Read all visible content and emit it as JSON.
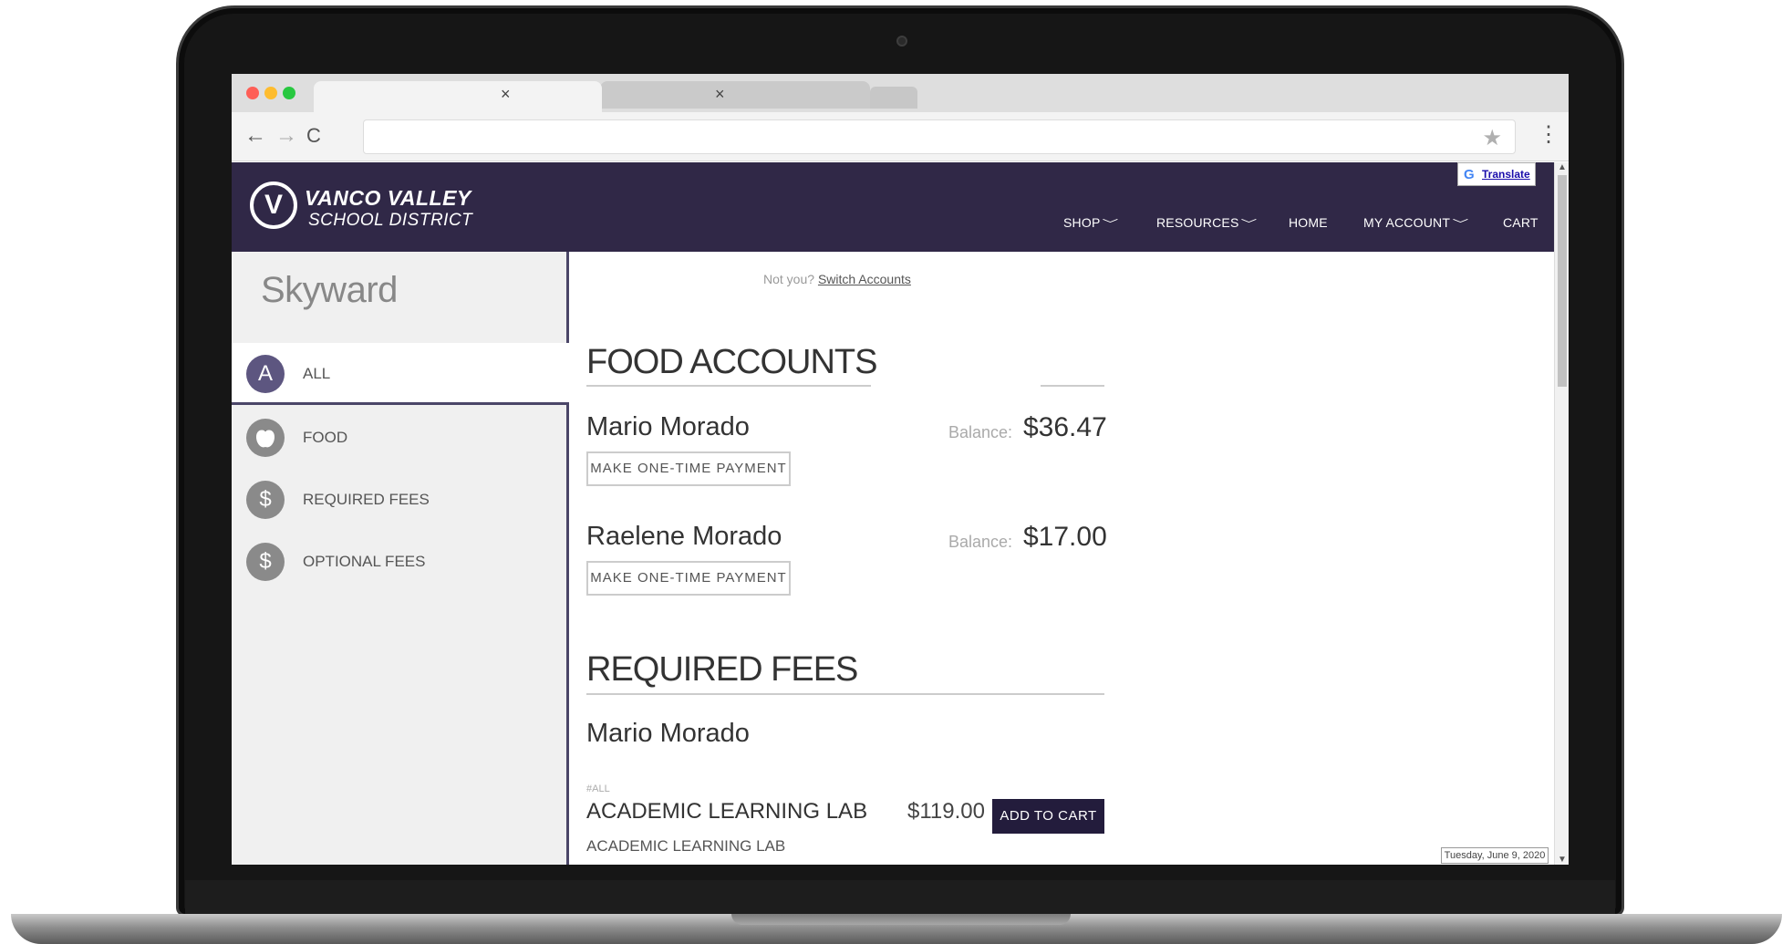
{
  "browser": {
    "traffic_light_colors": [
      "#fe5f57",
      "#febc2e",
      "#28c840"
    ],
    "tab_close_glyph": "×",
    "back_glyph": "←",
    "forward_glyph": "→",
    "reload_glyph": "C",
    "address_value": "",
    "star_glyph": "★",
    "menu_glyph": "⋮"
  },
  "header": {
    "logo_letter": "V",
    "brand_line1": "VANCO VALLEY",
    "brand_line2": "SCHOOL DISTRICT",
    "translate_label": "Translate",
    "nav": {
      "shop": "SHOP",
      "resources": "RESOURCES",
      "home": "HOME",
      "my_account": "MY ACCOUNT",
      "cart": "CART"
    },
    "chevron_glyph": "﹀",
    "bg_color": "#302847"
  },
  "sidebar": {
    "title": "Skyward",
    "items": [
      {
        "icon": "A",
        "label": "ALL"
      },
      {
        "icon": "",
        "label": "FOOD"
      },
      {
        "icon": "$",
        "label": "REQUIRED FEES"
      },
      {
        "icon": "$",
        "label": "OPTIONAL FEES"
      }
    ]
  },
  "main": {
    "not_you": "Not you?",
    "switch_accounts": "Switch Accounts",
    "food_accounts_title": "FOOD ACCOUNTS",
    "balance_label": "Balance:",
    "one_time_label": "MAKE ONE-TIME PAYMENT",
    "accounts": [
      {
        "name": "Mario Morado",
        "balance": "$36.47"
      },
      {
        "name": "Raelene Morado",
        "balance": "$17.00"
      }
    ],
    "required_fees_title": "REQUIRED FEES",
    "fee_student": "Mario Morado",
    "fee_tag": "#ALL",
    "fee_title": "ACADEMIC LEARNING LAB",
    "fee_price": "$119.00",
    "add_to_cart": "ADD TO CART",
    "fee_desc": "ACADEMIC LEARNING LAB"
  },
  "status": {
    "date_tooltip": "Tuesday, June 9, 2020"
  }
}
